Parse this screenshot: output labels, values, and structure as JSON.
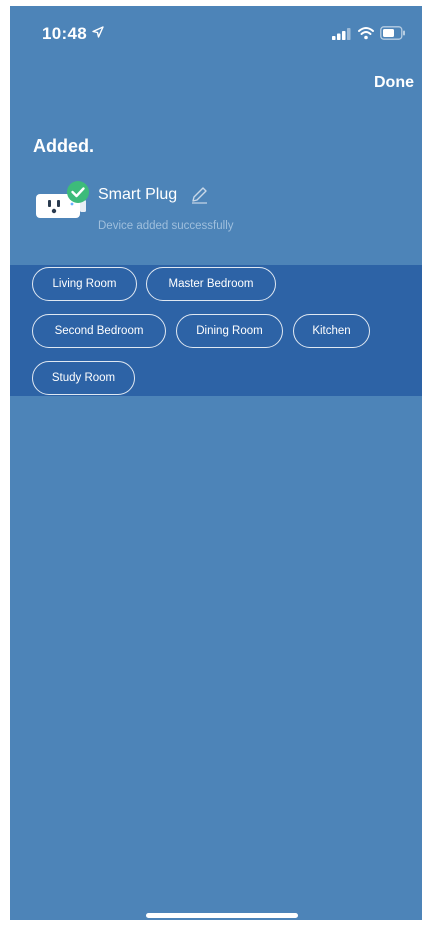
{
  "status_bar": {
    "time": "10:48",
    "location_icon": "location-arrow-icon",
    "signal_icon": "cellular-signal-icon",
    "wifi_icon": "wifi-icon",
    "battery_icon": "battery-icon"
  },
  "header": {
    "done_label": "Done"
  },
  "title": "Added.",
  "device": {
    "icon": "smart-plug-icon",
    "badge_icon": "check-badge-icon",
    "name": "Smart Plug",
    "edit_icon": "pencil-icon",
    "status": "Device added successfully"
  },
  "rooms": [
    {
      "label": "Living Room"
    },
    {
      "label": "Master Bedroom"
    },
    {
      "label": "Second Bedroom"
    },
    {
      "label": "Dining Room"
    },
    {
      "label": "Kitchen"
    },
    {
      "label": "Study Room"
    }
  ],
  "colors": {
    "background": "#4d84b8",
    "room_panel": "#2d63a6",
    "success_badge": "#3dbb7a",
    "text": "#ffffff",
    "subtext": "#9fbfdd"
  }
}
